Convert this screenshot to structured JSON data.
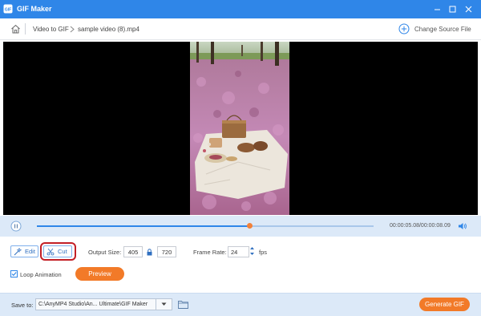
{
  "window": {
    "title": "GIF Maker",
    "accent": "#2f86e8",
    "orange": "#f27a28"
  },
  "breadcrumb": {
    "items": [
      "Video to GIF",
      "sample video (8).mp4"
    ],
    "change_source": "Change Source File"
  },
  "player": {
    "current_time": "00:00:05.08",
    "total_time": "00:00:08.09",
    "time_display": "00:00:05.08/00:00:08.09",
    "progress_fraction": 0.63
  },
  "controls": {
    "edit_label": "Edit",
    "cut_label": "Cut",
    "output_size_label": "Output Size:",
    "width": "405",
    "height": "720",
    "frame_rate_label": "Frame Rate:",
    "frame_rate": "24",
    "fps_label": "fps",
    "loop_label": "Loop Animation",
    "loop_checked": true,
    "preview_label": "Preview"
  },
  "footer": {
    "save_to_label": "Save to:",
    "save_path": "C:\\AnyMP4 Studio\\An... Ultimate\\GIF Maker",
    "generate_label": "Generate GIF"
  }
}
